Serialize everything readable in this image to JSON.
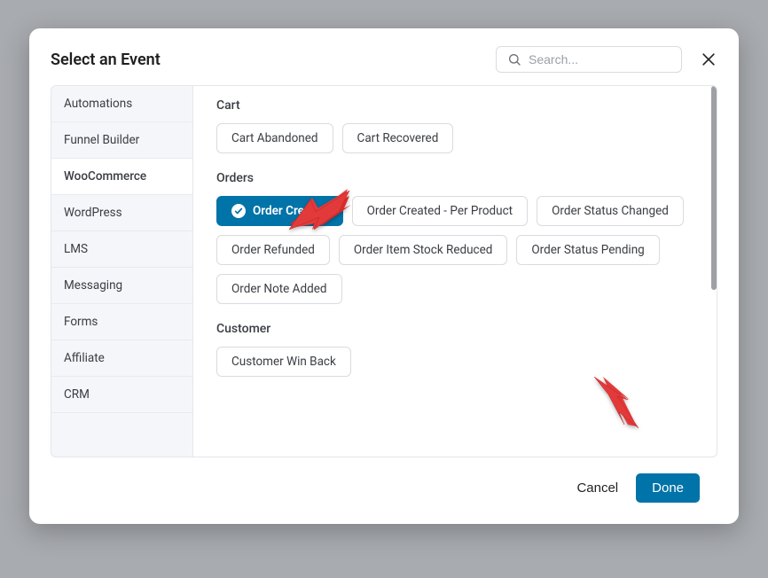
{
  "header": {
    "title": "Select an Event",
    "search_placeholder": "Search..."
  },
  "sidebar": {
    "items": [
      {
        "label": "Automations",
        "active": false
      },
      {
        "label": "Funnel Builder",
        "active": false
      },
      {
        "label": "WooCommerce",
        "active": true
      },
      {
        "label": "WordPress",
        "active": false
      },
      {
        "label": "LMS",
        "active": false
      },
      {
        "label": "Messaging",
        "active": false
      },
      {
        "label": "Forms",
        "active": false
      },
      {
        "label": "Affiliate",
        "active": false
      },
      {
        "label": "CRM",
        "active": false
      }
    ]
  },
  "sections": [
    {
      "title": "Cart",
      "options": [
        {
          "label": "Cart Abandoned",
          "selected": false
        },
        {
          "label": "Cart Recovered",
          "selected": false
        }
      ]
    },
    {
      "title": "Orders",
      "options": [
        {
          "label": "Order Created",
          "selected": true
        },
        {
          "label": "Order Created - Per Product",
          "selected": false
        },
        {
          "label": "Order Status Changed",
          "selected": false
        },
        {
          "label": "Order Refunded",
          "selected": false
        },
        {
          "label": "Order Item Stock Reduced",
          "selected": false
        },
        {
          "label": "Order Status Pending",
          "selected": false
        },
        {
          "label": "Order Note Added",
          "selected": false
        }
      ]
    },
    {
      "title": "Customer",
      "options": [
        {
          "label": "Customer Win Back",
          "selected": false
        }
      ]
    }
  ],
  "footer": {
    "cancel_label": "Cancel",
    "done_label": "Done"
  }
}
